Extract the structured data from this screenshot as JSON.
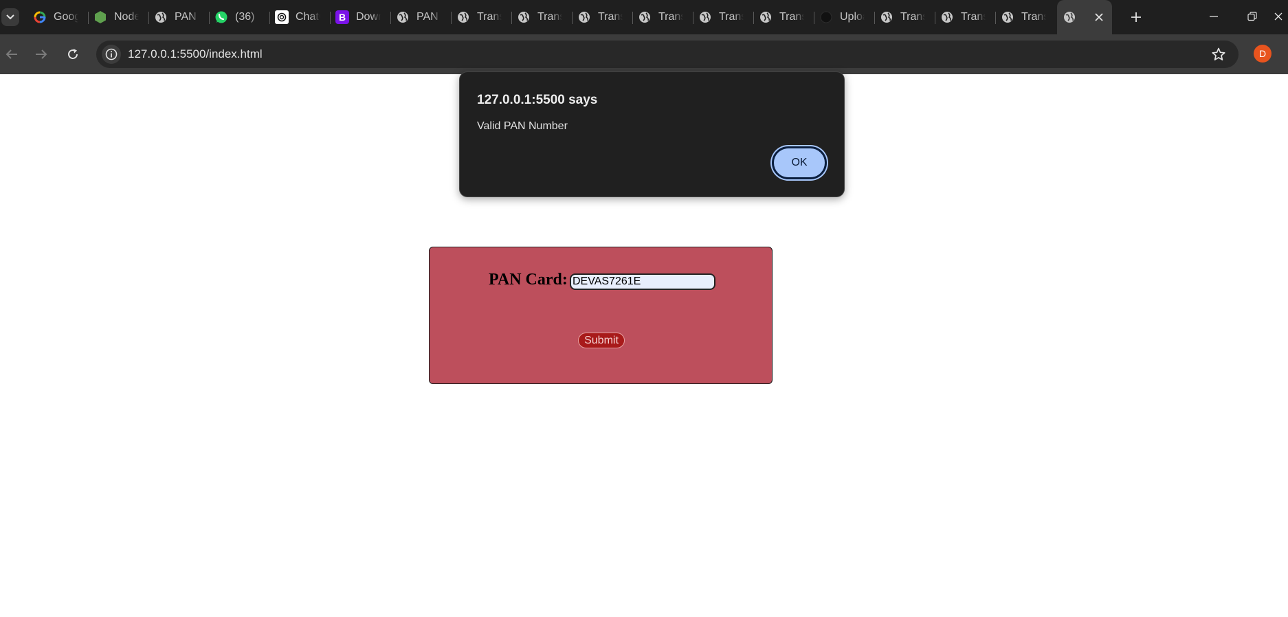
{
  "browser": {
    "tabs": [
      {
        "title": "Google",
        "icon": "google-icon"
      },
      {
        "title": "Node",
        "icon": "nodejs-icon"
      },
      {
        "title": "PAN",
        "icon": "globe-icon"
      },
      {
        "title": "(36)",
        "icon": "whatsapp-icon"
      },
      {
        "title": "ChatGPT",
        "icon": "chatgpt-icon"
      },
      {
        "title": "Download",
        "icon": "bootstrap-icon"
      },
      {
        "title": "PAN",
        "icon": "globe-icon"
      },
      {
        "title": "Translate",
        "icon": "globe-icon"
      },
      {
        "title": "Translate",
        "icon": "globe-icon"
      },
      {
        "title": "Translate",
        "icon": "globe-icon"
      },
      {
        "title": "Translate",
        "icon": "globe-icon"
      },
      {
        "title": "Translate",
        "icon": "globe-icon"
      },
      {
        "title": "Translate",
        "icon": "globe-icon"
      },
      {
        "title": "Upload",
        "icon": "github-icon"
      },
      {
        "title": "Translate",
        "icon": "globe-icon"
      },
      {
        "title": "Translate",
        "icon": "globe-icon"
      },
      {
        "title": "Translate",
        "icon": "globe-icon"
      }
    ],
    "url": "127.0.0.1:5500/index.html",
    "profile_initial": "D",
    "profile_color": "#e8541e"
  },
  "alert": {
    "title": "127.0.0.1:5500 says",
    "message": "Valid PAN Number",
    "ok_label": "OK"
  },
  "form": {
    "label": "PAN Card:",
    "pan_value": "DEVAS7261E",
    "submit_label": "Submit",
    "box_color": "#bd4f5c"
  }
}
